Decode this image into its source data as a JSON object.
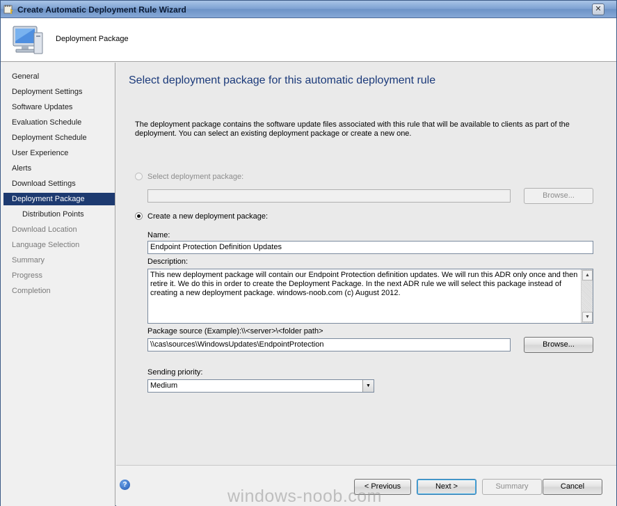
{
  "window": {
    "title": "Create Automatic Deployment Rule Wizard",
    "close_glyph": "✕"
  },
  "header": {
    "title": "Deployment Package"
  },
  "nav": {
    "items": [
      {
        "label": "General",
        "state": "normal"
      },
      {
        "label": "Deployment Settings",
        "state": "normal"
      },
      {
        "label": "Software Updates",
        "state": "normal"
      },
      {
        "label": "Evaluation Schedule",
        "state": "normal"
      },
      {
        "label": "Deployment Schedule",
        "state": "normal"
      },
      {
        "label": "User Experience",
        "state": "normal"
      },
      {
        "label": "Alerts",
        "state": "normal"
      },
      {
        "label": "Download Settings",
        "state": "normal"
      },
      {
        "label": "Deployment Package",
        "state": "active"
      },
      {
        "label": "Distribution Points",
        "state": "sub"
      },
      {
        "label": "Download Location",
        "state": "disabled"
      },
      {
        "label": "Language Selection",
        "state": "disabled"
      },
      {
        "label": "Summary",
        "state": "disabled"
      },
      {
        "label": "Progress",
        "state": "disabled"
      },
      {
        "label": "Completion",
        "state": "disabled"
      }
    ]
  },
  "main": {
    "title": "Select deployment package for this automatic deployment rule",
    "description": "The deployment package contains the software update files associated with this rule that will be available to clients as part of the deployment. You can select an existing deployment package or create a new one.",
    "select_existing": {
      "label": "Select deployment package:",
      "value": "",
      "browse_label": "Browse...",
      "checked": false
    },
    "create_new": {
      "label": "Create a new deployment package:",
      "checked": true
    },
    "name": {
      "label": "Name:",
      "value": "Endpoint Protection Definition Updates"
    },
    "description_field": {
      "label": "Description:",
      "value": "This new deployment package will contain our Endpoint Protection definition updates. We will run this ADR only once and then retire it. We do this in order to create the Deployment Package. In the next ADR rule we will select this package instead of creating a new deployment  package.  windows-noob.com (c) August 2012."
    },
    "package_source": {
      "label": "Package source (Example):\\\\<server>\\<folder path>",
      "value": "\\\\cas\\sources\\WindowsUpdates\\EndpointProtection",
      "browse_label": "Browse..."
    },
    "sending_priority": {
      "label": "Sending priority:",
      "value": "Medium"
    }
  },
  "footer": {
    "help_glyph": "?",
    "previous_label": "< Previous",
    "next_label": "Next >",
    "summary_label": "Summary",
    "cancel_label": "Cancel"
  },
  "watermark": "windows-noob.com",
  "colors": {
    "title_blue": "#1b3a7a",
    "nav_active_bg": "#1d3a70"
  }
}
